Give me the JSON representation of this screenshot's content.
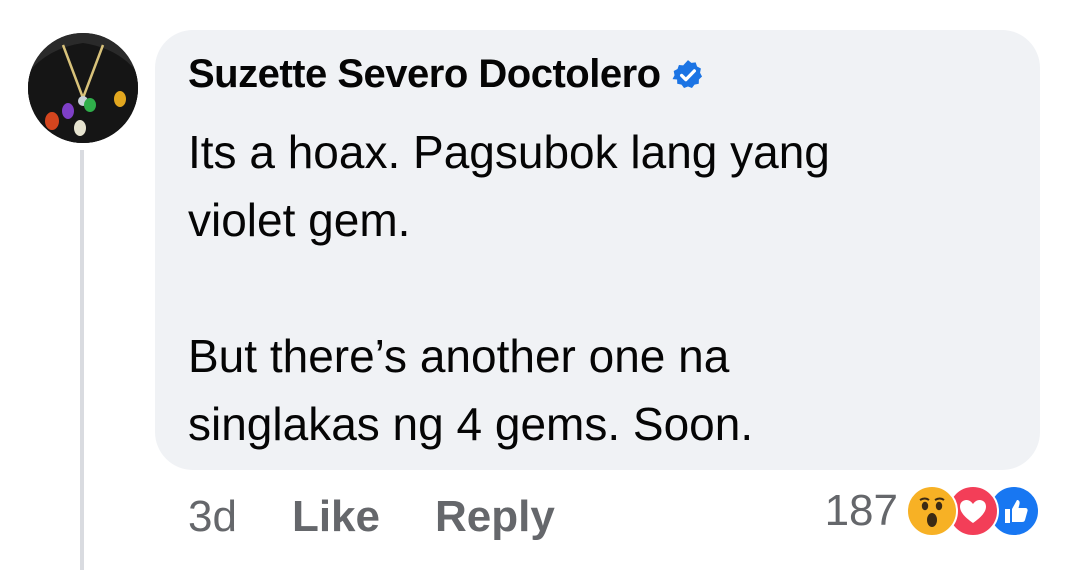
{
  "comment": {
    "author": "Suzette Severo Doctolero",
    "verified": true,
    "text": "Its a hoax. Pagsubok lang yang\nviolet gem.\n\nBut there’s another one na\nsinglakas ng 4 gems.   Soon."
  },
  "actions": {
    "time": "3d",
    "like_label": "Like",
    "reply_label": "Reply"
  },
  "reactions": {
    "count": "187",
    "icons": [
      "wow-icon",
      "love-icon",
      "like-icon"
    ]
  },
  "colors": {
    "bubble": "#f0f2f5",
    "text": "#050505",
    "secondary": "#65676b",
    "verified": "#1b74e4",
    "like": "#1877f2",
    "love": "#f33e58",
    "wow": "#f7b125"
  }
}
